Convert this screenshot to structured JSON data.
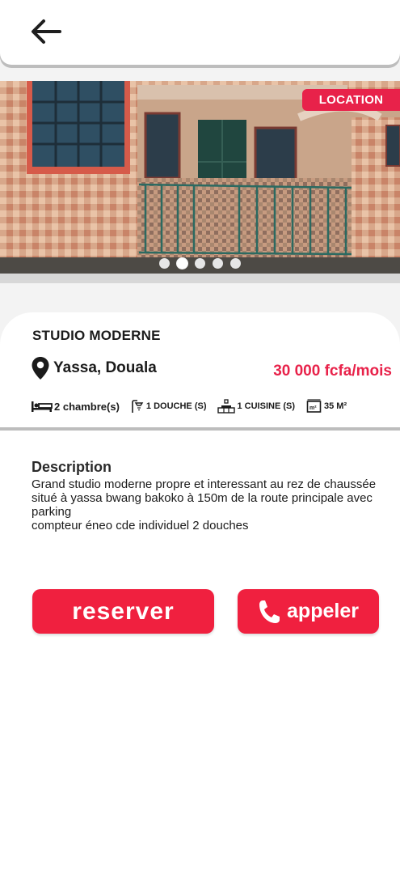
{
  "header": {
    "back_icon": "arrow-left-icon"
  },
  "listing": {
    "badge": "LOCATION",
    "photo_count": 5,
    "active_photo": 2,
    "title": "STUDIO MODERNE",
    "location": "Yassa, Douala",
    "price": "30 000 fcfa/mois",
    "features": [
      {
        "icon": "bed-icon",
        "label": "2 chambre(s)"
      },
      {
        "icon": "shower-icon",
        "label": "1 DOUCHE (S)"
      },
      {
        "icon": "kitchen-icon",
        "label": "1 CUISINE (S)"
      },
      {
        "icon": "area-icon",
        "label": "35 M²"
      }
    ]
  },
  "description": {
    "heading": "Description",
    "text": "Grand studio moderne propre et interessant au rez de chaussée situé à yassa bwang  bakoko à 150m de la route principale avec  parking\ncompteur éneo cde individuel 2 douches"
  },
  "actions": {
    "reserve_label": "reserver",
    "call_label": "appeler",
    "call_icon": "phone-icon"
  },
  "colors": {
    "accent": "#f0203f",
    "badge": "#e8224a",
    "price": "#e8224a"
  }
}
